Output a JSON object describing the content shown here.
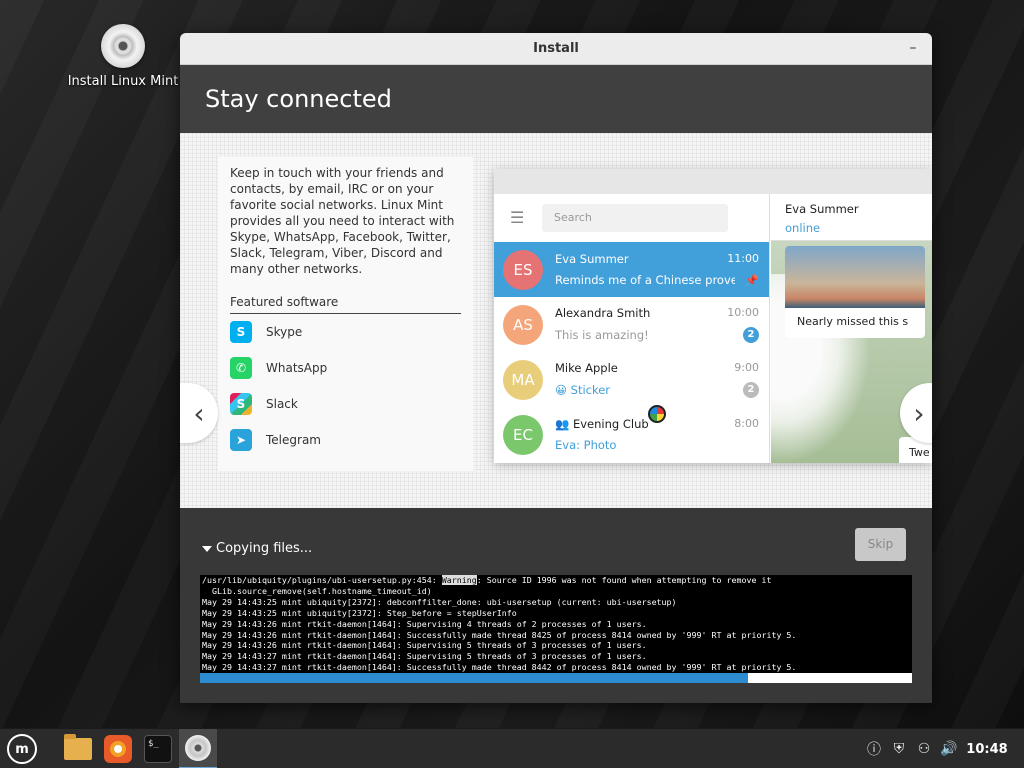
{
  "desktop": {
    "install_icon_label": "Install Linux Mint",
    "install_icon": "disc-icon"
  },
  "window": {
    "title": "Install",
    "minimize_glyph": "–"
  },
  "header": {
    "title": "Stay connected"
  },
  "slide": {
    "description": "Keep in touch with your friends and contacts, by email, IRC or on your favorite social networks. Linux Mint provides all you need to interact with Skype, WhatsApp, Facebook, Twitter, Slack, Telegram, Viber, Discord and many other networks.",
    "featured_heading": "Featured software",
    "featured": [
      {
        "label": "Skype",
        "icon": "skype-icon",
        "glyph": "S"
      },
      {
        "label": "WhatsApp",
        "icon": "whatsapp-icon",
        "glyph": "✆"
      },
      {
        "label": "Slack",
        "icon": "slack-icon",
        "glyph": "S"
      },
      {
        "label": "Telegram",
        "icon": "telegram-icon",
        "glyph": "➤"
      }
    ],
    "prev_glyph": "‹",
    "next_glyph": "›"
  },
  "telegram": {
    "search_placeholder": "Search",
    "menu_glyph": "☰",
    "chats": [
      {
        "initials": "ES",
        "name": "Eva Summer",
        "time": "11:00",
        "preview": "Reminds me of a Chinese prover…",
        "avatar_color": "#e57373",
        "pin": "📌"
      },
      {
        "initials": "AS",
        "name": "Alexandra Smith",
        "time": "10:00",
        "preview": "This is amazing!",
        "avatar_color": "#f4a57a",
        "badge": "2"
      },
      {
        "initials": "MA",
        "name": "Mike Apple",
        "time": "9:00",
        "preview": "😀 Sticker",
        "avatar_color": "#e8cd7a",
        "badge": "2"
      },
      {
        "initials": "EC",
        "name": "👥 Evening Club",
        "time": "8:00",
        "preview": "Eva: Photo",
        "avatar_color": "#7bc86c"
      }
    ],
    "peer_name": "Eva Summer",
    "peer_status": "online",
    "photo_caption": "Nearly missed this s",
    "tweet_text": "Twe"
  },
  "progress": {
    "status": "Copying files...",
    "skip_label": "Skip",
    "percent": 77,
    "log_lines": [
      {
        "pre": "/usr/lib/ubiquity/plugins/ubi-usersetup.py:454: ",
        "hl": "Warning",
        "post": ": Source ID 1996 was not found when attempting to remove it"
      },
      {
        "pre": "  GLib.source_remove(self.hostname_timeout_id)",
        "hl": "",
        "post": ""
      },
      {
        "pre": "May 29 14:43:25 mint ubiquity[2372]: debconffilter_done: ubi-usersetup (current: ubi-usersetup)",
        "hl": "",
        "post": ""
      },
      {
        "pre": "May 29 14:43:25 mint ubiquity[2372]: Step_before = stepUserInfo",
        "hl": "",
        "post": ""
      },
      {
        "pre": "May 29 14:43:26 mint rtkit-daemon[1464]: Supervising 4 threads of 2 processes of 1 users.",
        "hl": "",
        "post": ""
      },
      {
        "pre": "May 29 14:43:26 mint rtkit-daemon[1464]: Successfully made thread 8425 of process 8414 owned by '999' RT at priority 5.",
        "hl": "",
        "post": ""
      },
      {
        "pre": "May 29 14:43:26 mint rtkit-daemon[1464]: Supervising 5 threads of 3 processes of 1 users.",
        "hl": "",
        "post": ""
      },
      {
        "pre": "May 29 14:43:27 mint rtkit-daemon[1464]: Supervising 5 threads of 3 processes of 1 users.",
        "hl": "",
        "post": ""
      },
      {
        "pre": "May 29 14:43:27 mint rtkit-daemon[1464]: Successfully made thread 8442 of process 8414 owned by '999' RT at priority 5.",
        "hl": "",
        "post": ""
      }
    ]
  },
  "taskbar": {
    "menu_icon": "linux-mint-menu-icon",
    "menu_glyph": "m",
    "apps": [
      "files-icon",
      "firefox-icon",
      "terminal-icon",
      "installer-disc-icon"
    ],
    "terminal_glyph": "$_",
    "tray": [
      {
        "icon": "update-manager-icon",
        "glyph": "ⓘ"
      },
      {
        "icon": "shield-icon",
        "glyph": "⛨"
      },
      {
        "icon": "network-icon",
        "glyph": "⚇"
      },
      {
        "icon": "volume-icon",
        "glyph": "🔊"
      }
    ],
    "clock": "10:48"
  }
}
